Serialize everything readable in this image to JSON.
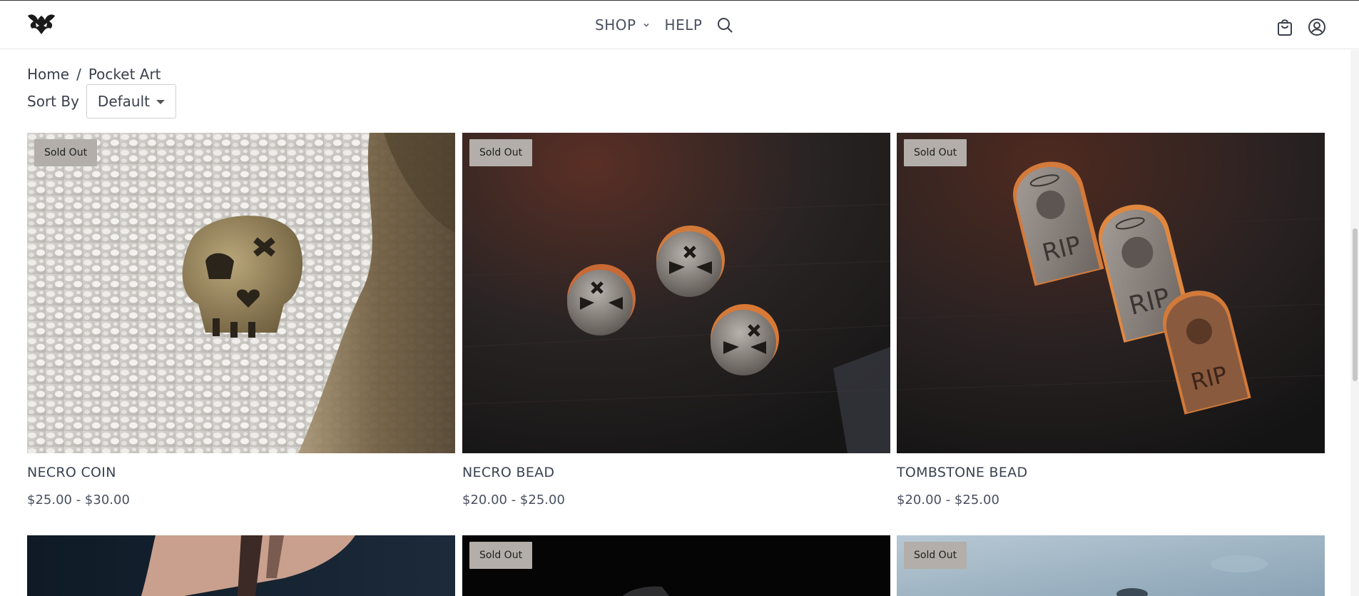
{
  "header": {
    "nav": {
      "shop": "SHOP",
      "help": "HELP"
    }
  },
  "breadcrumb": {
    "home": "Home",
    "separator": "/",
    "current": "Pocket Art"
  },
  "sort": {
    "label": "Sort By",
    "value": "Default"
  },
  "products": [
    {
      "name": "NECRO COIN",
      "price": "$25.00 - $30.00",
      "badge": "Sold Out"
    },
    {
      "name": "NECRO BEAD",
      "price": "$20.00 - $25.00",
      "badge": "Sold Out"
    },
    {
      "name": "TOMBSTONE BEAD",
      "price": "$20.00 - $25.00",
      "badge": "Sold Out"
    }
  ],
  "row2_badges": [
    "",
    "Sold Out",
    "Sold Out"
  ],
  "colors": {
    "badge_bg": "#b3aea9",
    "text": "#3a3f4b"
  }
}
